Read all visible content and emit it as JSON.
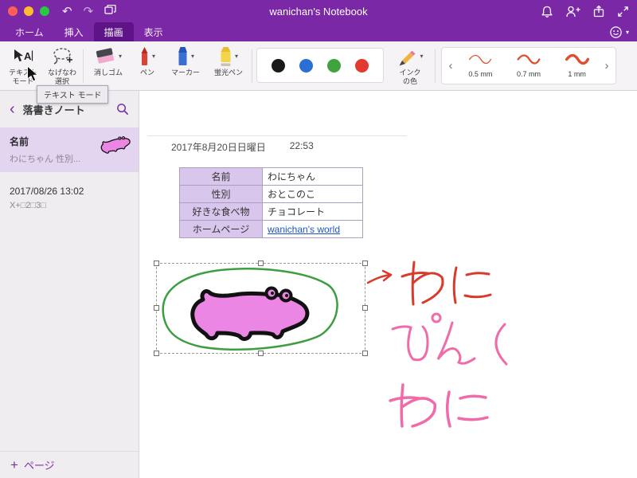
{
  "colors": {
    "titlebar_purple": "#7A28A5",
    "active_tab_purple": "#5E1486",
    "accent_purple": "#7C2FA6",
    "selected_page_bg": "#E3D4F0",
    "table_header_bg": "#D8C6EC",
    "link_blue": "#1F53C5",
    "pen_stroke_red": "#D93A2B",
    "handwriting_pink": "#F06BA8",
    "enclosure_green": "#3C9E41",
    "crocodile_pink": "#EC86E4"
  },
  "titlebar": {
    "title": "wanichan's Notebook"
  },
  "tabs": [
    {
      "label": "ホーム"
    },
    {
      "label": "挿入"
    },
    {
      "label": "描画"
    },
    {
      "label": "表示"
    }
  ],
  "ribbon": {
    "text_mode_label1": "テキスト",
    "text_mode_label2": "モード",
    "lasso_label1": "なげなわ",
    "lasso_label2": "選択",
    "eraser_label": "消しゴム",
    "pen_label": "ペン",
    "marker_label": "マーカー",
    "highlighter_label": "蛍光ペン",
    "ink_color_label1": "インク",
    "ink_color_label2": "の色",
    "ink_palette": [
      "#1A1A1A",
      "#2B6FD4",
      "#3FA33F",
      "#E23A2E"
    ],
    "stroke_widths": [
      "0.5 mm",
      "0.7 mm",
      "1 mm"
    ]
  },
  "tooltip_text": "テキスト モード",
  "sidebar": {
    "title": "落書きノート",
    "pages": [
      {
        "title": "名前",
        "subtitle": "わにちゃん 性別..."
      },
      {
        "title": "2017/08/26 13:02",
        "subtitle": "X+□2□3□"
      }
    ],
    "add_page_label": "ページ"
  },
  "page": {
    "date": "2017年8月20日日曜日",
    "time": "22:53",
    "table_rows": [
      {
        "label": "名前",
        "value": "わにちゃん"
      },
      {
        "label": "性別",
        "value": "おとこのこ"
      },
      {
        "label": "好きな食べ物",
        "value": "チョコレート"
      },
      {
        "label": "ホームページ",
        "value": "wanichan's world"
      }
    ],
    "handwriting": {
      "arrow_text": "わに",
      "pink_word1": "ぴんく",
      "pink_word2": "わに"
    }
  }
}
